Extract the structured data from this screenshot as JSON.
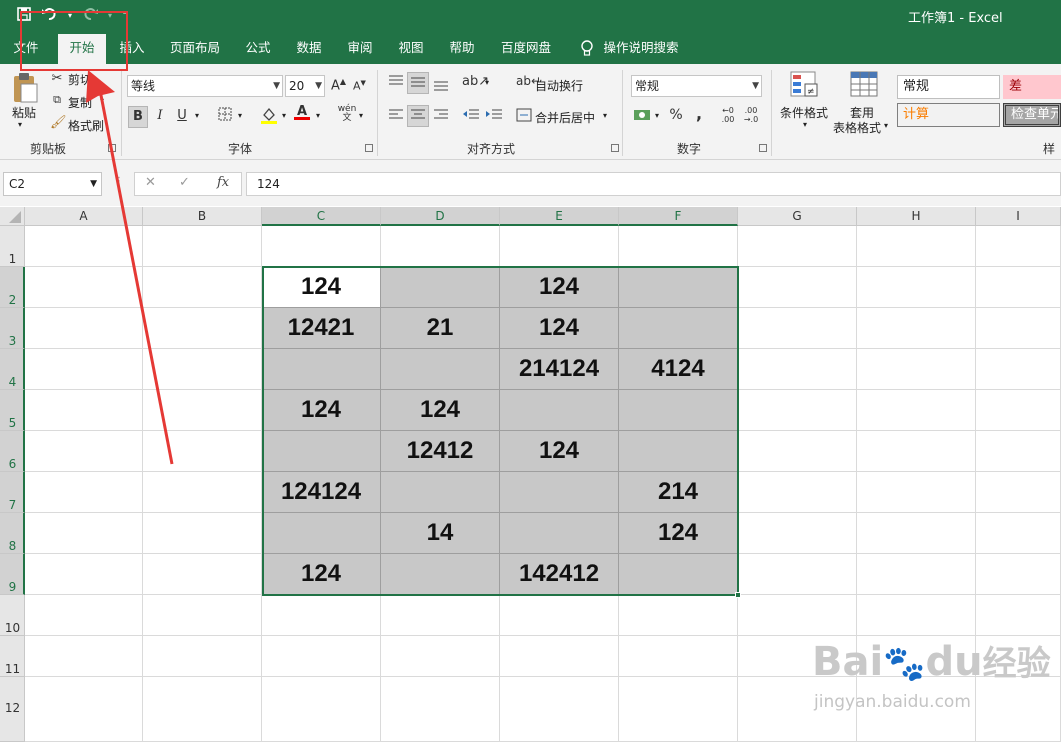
{
  "quick_access": {
    "save_icon": "save-icon",
    "undo_icon": "undo-icon",
    "redo_icon": "redo-icon"
  },
  "window": {
    "title": "工作簿1  -  Excel"
  },
  "tabs": [
    {
      "label": "文件"
    },
    {
      "label": "开始"
    },
    {
      "label": "插入"
    },
    {
      "label": "页面布局"
    },
    {
      "label": "公式"
    },
    {
      "label": "数据"
    },
    {
      "label": "审阅"
    },
    {
      "label": "视图"
    },
    {
      "label": "帮助"
    },
    {
      "label": "百度网盘"
    },
    {
      "label": "操作说明搜索"
    }
  ],
  "ribbon": {
    "clipboard": {
      "paste_label": "粘贴",
      "cut_label": "剪切",
      "copy_label": "复制",
      "format_painter_label": "格式刷",
      "group_label": "剪贴板"
    },
    "font": {
      "font_name": "等线",
      "font_size": "20",
      "bold": "B",
      "italic": "I",
      "underline": "U",
      "group_label": "字体"
    },
    "alignment": {
      "wrap_text_label": "自动换行",
      "merge_center_label": "合并后居中",
      "group_label": "对齐方式"
    },
    "number": {
      "format_value": "常规",
      "percent": "%",
      "comma": ",",
      "group_label": "数字"
    },
    "styles": {
      "conditional_format_label": "条件格式",
      "table_format_label_1": "套用",
      "table_format_label_2": "表格格式",
      "style_normal": "常规",
      "style_bad": "差",
      "style_calculation": "计算",
      "style_check_cell": "检查单元",
      "group_label_partial": "样"
    }
  },
  "formula_bar": {
    "name_box": "C2",
    "fx_label": "fx",
    "formula_value": "124"
  },
  "grid": {
    "columns": [
      "A",
      "B",
      "C",
      "D",
      "E",
      "F",
      "G",
      "H",
      "I"
    ],
    "rows": [
      "1",
      "2",
      "3",
      "4",
      "5",
      "6",
      "7",
      "8",
      "9",
      "10",
      "11",
      "12"
    ],
    "data_rows": [
      {
        "row": "2",
        "cells": [
          "124",
          "",
          "124",
          ""
        ]
      },
      {
        "row": "3",
        "cells": [
          "12421",
          "21",
          "124",
          ""
        ]
      },
      {
        "row": "4",
        "cells": [
          "",
          "",
          "214124",
          "4124"
        ]
      },
      {
        "row": "5",
        "cells": [
          "124",
          "124",
          "",
          ""
        ]
      },
      {
        "row": "6",
        "cells": [
          "",
          "12412",
          "124",
          ""
        ]
      },
      {
        "row": "7",
        "cells": [
          "124124",
          "",
          "",
          "214"
        ]
      },
      {
        "row": "8",
        "cells": [
          "",
          "14",
          "",
          "124"
        ]
      },
      {
        "row": "9",
        "cells": [
          "124",
          "",
          "142412",
          ""
        ]
      }
    ],
    "active_cell": "C2",
    "selection_range": "C2:F9",
    "fill_color": "#c8c8c8"
  },
  "colors": {
    "excel_green": "#217346",
    "annotation_red": "#e53935"
  },
  "watermark": {
    "brand_big": "Bai",
    "brand_du": "du",
    "brand_cn": "经验",
    "url": "jingyan.baidu.com"
  }
}
